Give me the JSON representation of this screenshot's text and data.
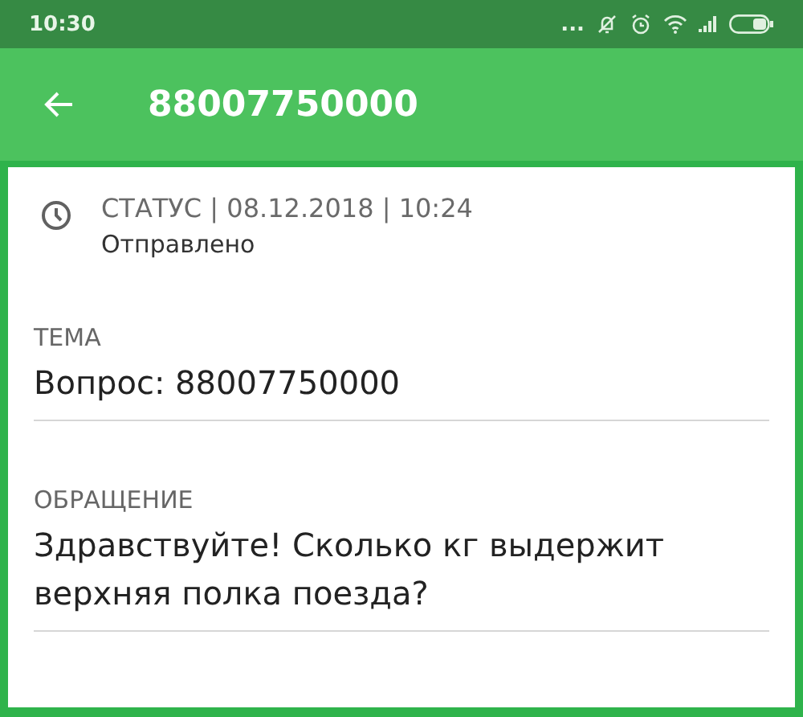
{
  "status_bar": {
    "time": "10:30",
    "more": "..."
  },
  "app_bar": {
    "title": "88007750000"
  },
  "status": {
    "label": "СТАТУС | 08.12.2018 | 10:24",
    "value": "Отправлено"
  },
  "fields": [
    {
      "label": "ТЕМА",
      "value": "Вопрос: 88007750000"
    },
    {
      "label": "ОБРАЩЕНИЕ",
      "value": "Здравствуйте! Сколько кг выдержит верхняя полка поезда?"
    }
  ]
}
